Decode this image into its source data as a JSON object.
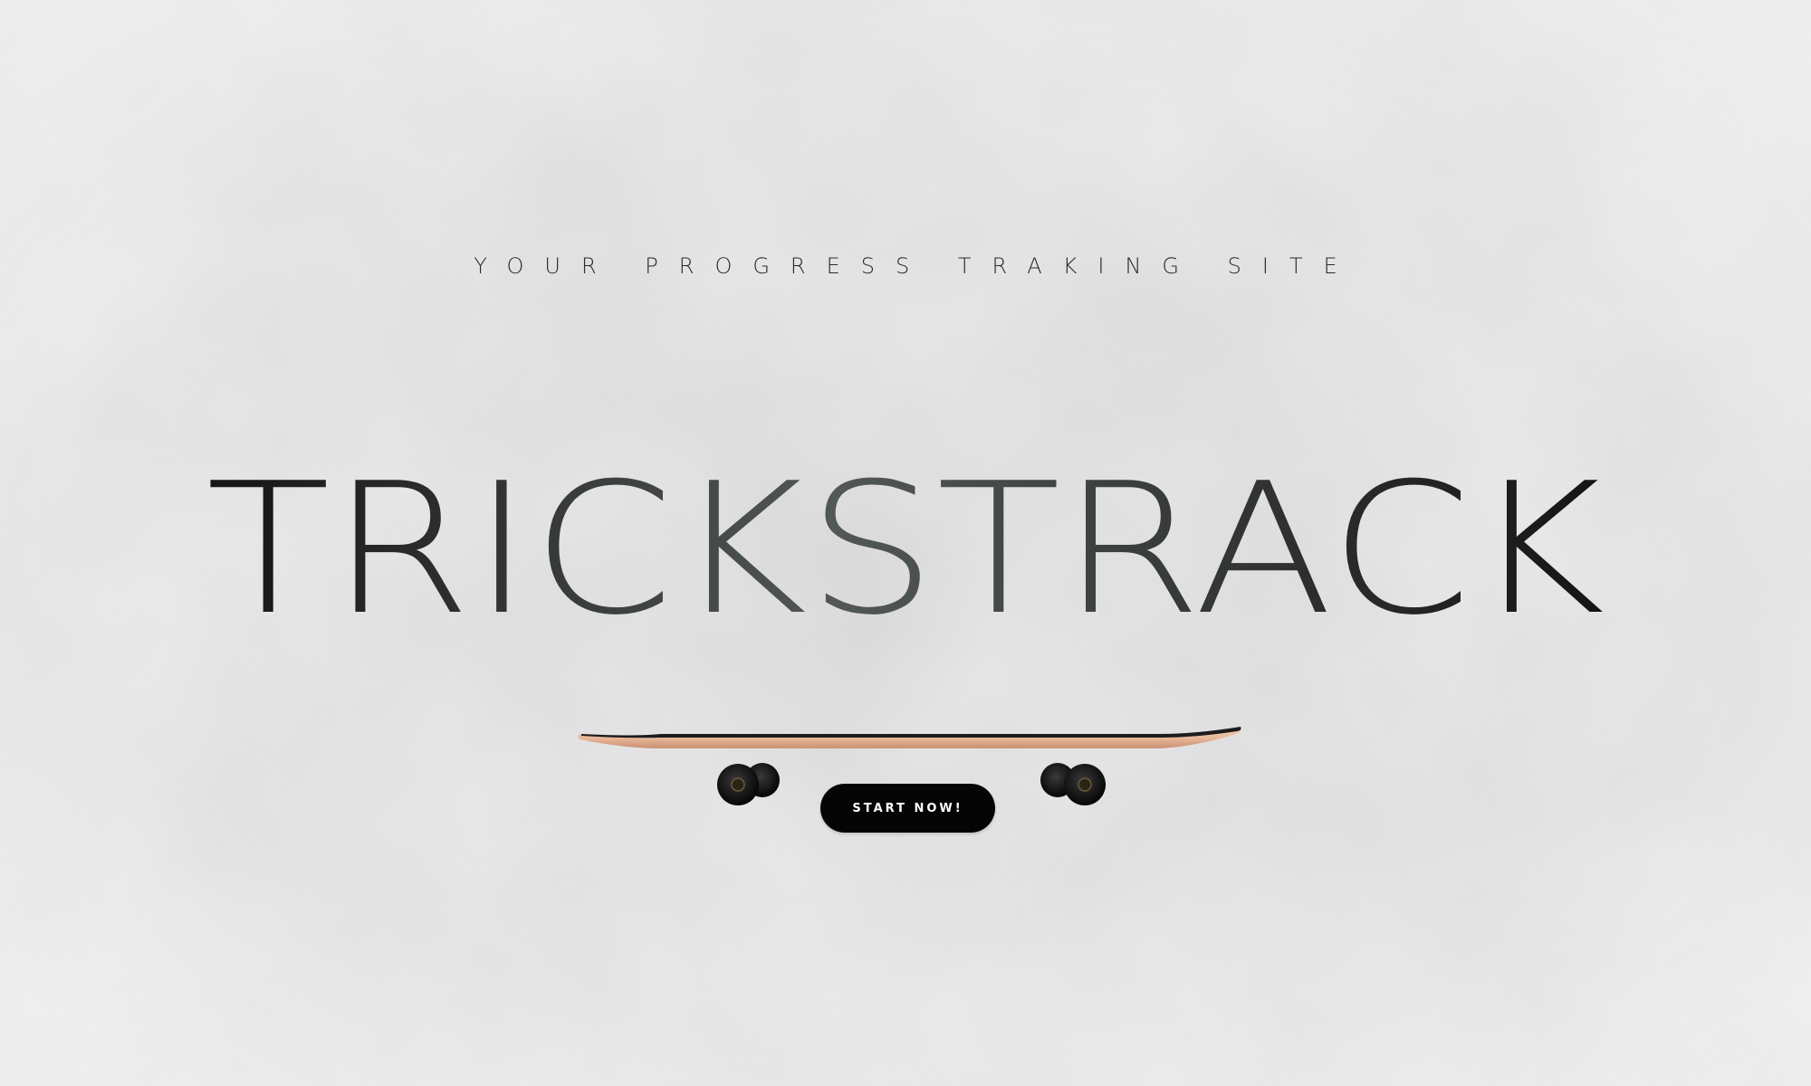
{
  "hero": {
    "tagline": "YOUR PROGRESS TRAKING SITE",
    "title": "TRICKSTRACK",
    "cta_label": "START NOW!"
  },
  "icons": {
    "illustration": "skateboard-icon"
  },
  "colors": {
    "background": "#e6e6e6",
    "title_dark": "#1b1c1b",
    "title_mid": "#4f5452",
    "button_bg": "#050505",
    "button_text": "#ffffff",
    "board_deck": "#e9bb9e",
    "board_grip": "#1a1a1a"
  }
}
